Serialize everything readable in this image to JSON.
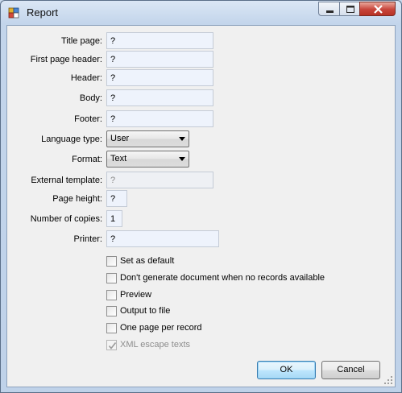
{
  "window": {
    "title": "Report"
  },
  "colors": {
    "accent": "#3c7fb1",
    "close_button": "#c7443a"
  },
  "icons": {
    "app": "report-app-icon",
    "minimize": "minimize-icon",
    "maximize": "maximize-icon",
    "close": "close-icon"
  },
  "form": {
    "title_page": {
      "label": "Title page:",
      "value": "?"
    },
    "first_page_header": {
      "label": "First page header:",
      "value": "?"
    },
    "header": {
      "label": "Header:",
      "value": "?"
    },
    "body": {
      "label": "Body:",
      "value": "?"
    },
    "footer": {
      "label": "Footer:",
      "value": "?"
    },
    "language_type": {
      "label": "Language type:",
      "value": "User"
    },
    "format": {
      "label": "Format:",
      "value": "Text"
    },
    "external_template": {
      "label": "External template:",
      "value": "?"
    },
    "page_height": {
      "label": "Page height:",
      "value": "?"
    },
    "number_of_copies": {
      "label": "Number of copies:",
      "value": "1"
    },
    "printer": {
      "label": "Printer:",
      "value": "?"
    }
  },
  "options": {
    "set_as_default": {
      "label": "Set as default",
      "checked": false
    },
    "no_records": {
      "label": "Don't generate document when no records available",
      "checked": false
    },
    "preview": {
      "label": "Preview",
      "checked": false
    },
    "output_to_file": {
      "label": "Output to file",
      "checked": false
    },
    "one_page_per_record": {
      "label": "One page per record",
      "checked": false
    },
    "xml_escape": {
      "label": "XML escape texts",
      "checked": true,
      "disabled": true
    }
  },
  "buttons": {
    "ok": "OK",
    "cancel": "Cancel"
  }
}
